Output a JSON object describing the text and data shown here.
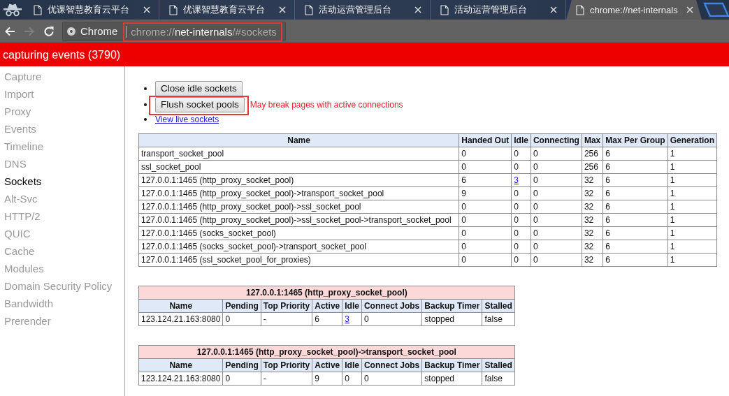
{
  "browser": {
    "tabs": [
      {
        "title": "优课智慧教育云平台",
        "selected": false
      },
      {
        "title": "优课智慧教育云平台",
        "selected": false
      },
      {
        "title": "活动运营管理后台",
        "selected": false
      },
      {
        "title": "活动运营管理后台",
        "selected": false
      },
      {
        "title": "chrome://net-internals",
        "selected": true
      }
    ],
    "nav_buttons": [
      {
        "kind": "back",
        "disabled": false
      },
      {
        "kind": "forward",
        "disabled": true
      },
      {
        "kind": "reload",
        "disabled": false
      }
    ],
    "omnibox": {
      "chip": "Chrome",
      "url": {
        "scheme": "chrome://",
        "host": "net-internals",
        "path": "/#sockets"
      },
      "highlighted": true
    }
  },
  "banner": {
    "text": "capturing events (3790)"
  },
  "sidebar": {
    "items": [
      {
        "label": "Capture",
        "selected": false
      },
      {
        "label": "Import",
        "selected": false
      },
      {
        "label": "Proxy",
        "selected": false
      },
      {
        "label": "Events",
        "selected": false
      },
      {
        "label": "Timeline",
        "selected": false
      },
      {
        "label": "DNS",
        "selected": false
      },
      {
        "label": "Sockets",
        "selected": true
      },
      {
        "label": "Alt-Svc",
        "selected": false
      },
      {
        "label": "HTTP/2",
        "selected": false
      },
      {
        "label": "QUIC",
        "selected": false
      },
      {
        "label": "Cache",
        "selected": false
      },
      {
        "label": "Modules",
        "selected": false
      },
      {
        "label": "Domain Security Policy",
        "selected": false
      },
      {
        "label": "Bandwidth",
        "selected": false
      },
      {
        "label": "Prerender",
        "selected": false
      }
    ]
  },
  "actions": [
    {
      "kind": "button",
      "label": "Close idle sockets",
      "highlighted": false
    },
    {
      "kind": "button",
      "label": "Flush socket pools",
      "highlighted": true,
      "warning": "May break pages with active connections"
    },
    {
      "kind": "link",
      "label": "View live sockets"
    }
  ],
  "pools_table": {
    "columns": [
      "Name",
      "Handed Out",
      "Idle",
      "Connecting",
      "Max",
      "Max Per Group",
      "Generation"
    ],
    "rows": [
      {
        "cells": [
          {
            "text": "transport_socket_pool",
            "link": false
          },
          {
            "text": "0",
            "link": false
          },
          {
            "text": "0",
            "link": false
          },
          {
            "text": "0",
            "link": false
          },
          {
            "text": "256",
            "link": false
          },
          {
            "text": "6",
            "link": false
          },
          {
            "text": "1",
            "link": false
          }
        ]
      },
      {
        "cells": [
          {
            "text": "ssl_socket_pool",
            "link": false
          },
          {
            "text": "0",
            "link": false
          },
          {
            "text": "0",
            "link": false
          },
          {
            "text": "0",
            "link": false
          },
          {
            "text": "256",
            "link": false
          },
          {
            "text": "6",
            "link": false
          },
          {
            "text": "1",
            "link": false
          }
        ]
      },
      {
        "cells": [
          {
            "text": "127.0.0.1:1465 (http_proxy_socket_pool)",
            "link": false
          },
          {
            "text": "6",
            "link": false
          },
          {
            "text": "3",
            "link": true
          },
          {
            "text": "0",
            "link": false
          },
          {
            "text": "32",
            "link": false
          },
          {
            "text": "6",
            "link": false
          },
          {
            "text": "1",
            "link": false
          }
        ]
      },
      {
        "cells": [
          {
            "text": "127.0.0.1:1465 (http_proxy_socket_pool)->transport_socket_pool",
            "link": false
          },
          {
            "text": "9",
            "link": false
          },
          {
            "text": "0",
            "link": false
          },
          {
            "text": "0",
            "link": false
          },
          {
            "text": "32",
            "link": false
          },
          {
            "text": "6",
            "link": false
          },
          {
            "text": "1",
            "link": false
          }
        ]
      },
      {
        "cells": [
          {
            "text": "127.0.0.1:1465 (http_proxy_socket_pool)->ssl_socket_pool",
            "link": false
          },
          {
            "text": "0",
            "link": false
          },
          {
            "text": "0",
            "link": false
          },
          {
            "text": "0",
            "link": false
          },
          {
            "text": "32",
            "link": false
          },
          {
            "text": "6",
            "link": false
          },
          {
            "text": "1",
            "link": false
          }
        ]
      },
      {
        "cells": [
          {
            "text": "127.0.0.1:1465 (http_proxy_socket_pool)->ssl_socket_pool->transport_socket_pool",
            "link": false
          },
          {
            "text": "0",
            "link": false
          },
          {
            "text": "0",
            "link": false
          },
          {
            "text": "0",
            "link": false
          },
          {
            "text": "32",
            "link": false
          },
          {
            "text": "6",
            "link": false
          },
          {
            "text": "1",
            "link": false
          }
        ]
      },
      {
        "cells": [
          {
            "text": "127.0.0.1:1465 (socks_socket_pool)",
            "link": false
          },
          {
            "text": "0",
            "link": false
          },
          {
            "text": "0",
            "link": false
          },
          {
            "text": "0",
            "link": false
          },
          {
            "text": "32",
            "link": false
          },
          {
            "text": "6",
            "link": false
          },
          {
            "text": "1",
            "link": false
          }
        ]
      },
      {
        "cells": [
          {
            "text": "127.0.0.1:1465 (socks_socket_pool)->transport_socket_pool",
            "link": false
          },
          {
            "text": "0",
            "link": false
          },
          {
            "text": "0",
            "link": false
          },
          {
            "text": "0",
            "link": false
          },
          {
            "text": "32",
            "link": false
          },
          {
            "text": "6",
            "link": false
          },
          {
            "text": "1",
            "link": false
          }
        ]
      },
      {
        "cells": [
          {
            "text": "127.0.0.1:1465 (ssl_socket_pool_for_proxies)",
            "link": false
          },
          {
            "text": "0",
            "link": false
          },
          {
            "text": "0",
            "link": false
          },
          {
            "text": "0",
            "link": false
          },
          {
            "text": "32",
            "link": false
          },
          {
            "text": "6",
            "link": false
          },
          {
            "text": "1",
            "link": false
          }
        ]
      }
    ]
  },
  "group_tables": [
    {
      "title": "127.0.0.1:1465 (http_proxy_socket_pool)",
      "columns": [
        "Name",
        "Pending",
        "Top Priority",
        "Active",
        "Idle",
        "Connect Jobs",
        "Backup Timer",
        "Stalled"
      ],
      "rows": [
        {
          "cells": [
            {
              "text": "123.124.21.163:8080",
              "link": false
            },
            {
              "text": "0",
              "link": false
            },
            {
              "text": "-",
              "link": false
            },
            {
              "text": "6",
              "link": false
            },
            {
              "text": "3",
              "link": true
            },
            {
              "text": "0",
              "link": false
            },
            {
              "text": "stopped",
              "link": false
            },
            {
              "text": "false",
              "link": false
            }
          ]
        }
      ]
    },
    {
      "title": "127.0.0.1:1465 (http_proxy_socket_pool)->transport_socket_pool",
      "columns": [
        "Name",
        "Pending",
        "Top Priority",
        "Active",
        "Idle",
        "Connect Jobs",
        "Backup Timer",
        "Stalled"
      ],
      "rows": [
        {
          "cells": [
            {
              "text": "123.124.21.163:8080",
              "link": false
            },
            {
              "text": "0",
              "link": false
            },
            {
              "text": "-",
              "link": false
            },
            {
              "text": "9",
              "link": false
            },
            {
              "text": "0",
              "link": false
            },
            {
              "text": "0",
              "link": false
            },
            {
              "text": "stopped",
              "link": false
            },
            {
              "text": "false",
              "link": false
            }
          ]
        }
      ]
    }
  ]
}
